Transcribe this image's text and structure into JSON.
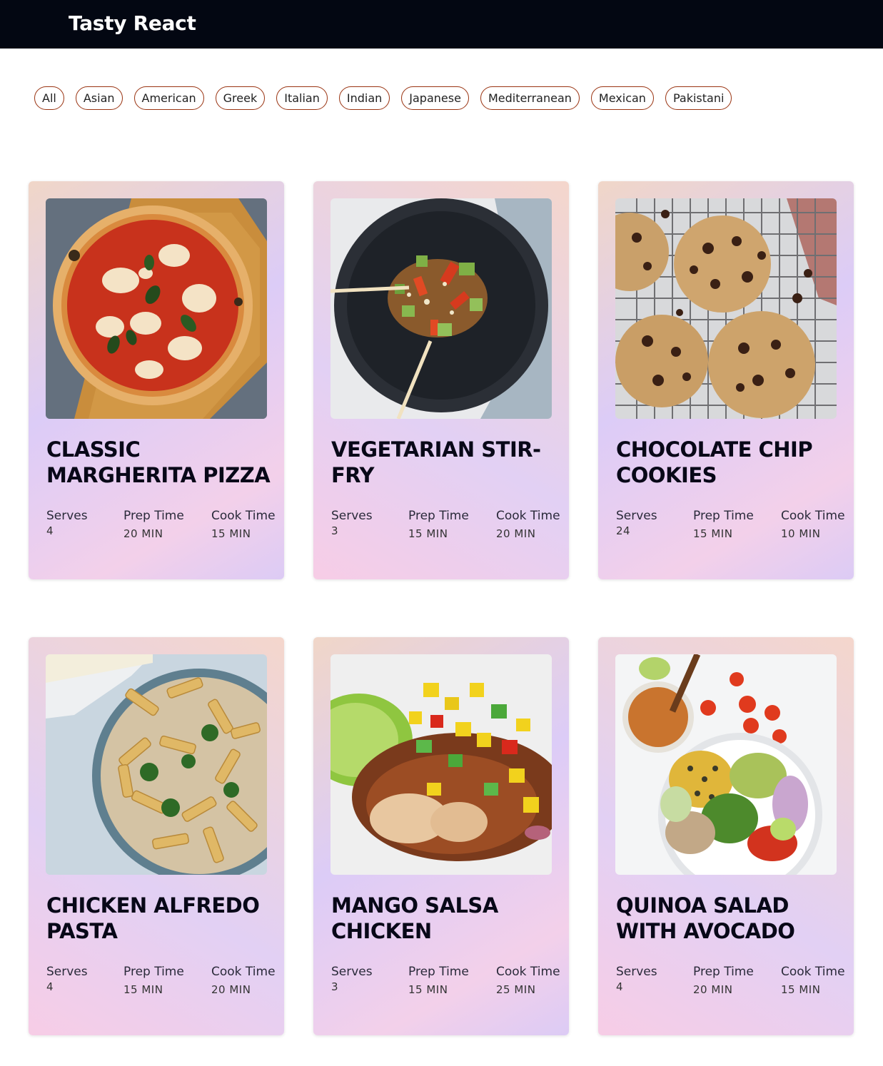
{
  "header": {
    "brand": "Tasty React"
  },
  "filters": [
    "All",
    "Asian",
    "American",
    "Greek",
    "Italian",
    "Indian",
    "Japanese",
    "Mediterranean",
    "Mexican",
    "Pakistani"
  ],
  "labels": {
    "serves": "Serves",
    "prep": "Prep Time",
    "cook": "Cook Time"
  },
  "recipes": [
    {
      "title": "Classic Margherita Pizza",
      "image": "pizza-photo",
      "serves": "4",
      "prep": "20 MIN",
      "cook": "15 MIN"
    },
    {
      "title": "Vegetarian Stir-Fry",
      "image": "stir-fry-photo",
      "serves": "3",
      "prep": "15 MIN",
      "cook": "20 MIN"
    },
    {
      "title": "Chocolate Chip Cookies",
      "image": "cookies-photo",
      "serves": "24",
      "prep": "15 MIN",
      "cook": "10 MIN"
    },
    {
      "title": "Chicken Alfredo Pasta",
      "image": "pasta-photo",
      "serves": "4",
      "prep": "15 MIN",
      "cook": "20 MIN"
    },
    {
      "title": "Mango Salsa Chicken",
      "image": "chicken-photo",
      "serves": "3",
      "prep": "15 MIN",
      "cook": "25 MIN"
    },
    {
      "title": "Quinoa Salad with Avocado",
      "image": "salad-photo",
      "serves": "4",
      "prep": "20 MIN",
      "cook": "15 MIN"
    }
  ]
}
